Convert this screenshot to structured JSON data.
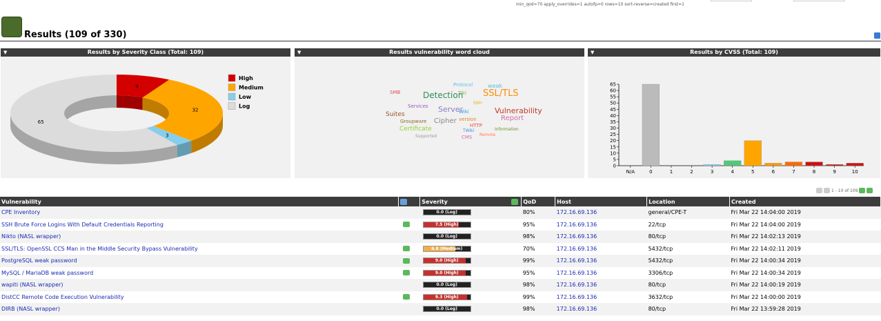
{
  "filter_text": "min_qod=70 apply_overrides=1 autofp=0 rows=10 sort-reverse=created first=1",
  "page_title": "Results (109 of 330)",
  "panels": {
    "severity_title": "Results by Severity Class (Total: 109)",
    "cloud_title": "Results vulnerability word cloud",
    "cvss_title": "Results by CVSS (Total: 109)"
  },
  "chart_data": [
    {
      "type": "pie",
      "title": "Results by Severity Class (Total: 109)",
      "categories": [
        "High",
        "Medium",
        "Low",
        "Log"
      ],
      "values": [
        9,
        32,
        3,
        65
      ],
      "colors": [
        "#d40000",
        "#ffa500",
        "#87ceeb",
        "#dcdcdc"
      ],
      "legend": "top-right"
    },
    {
      "type": "bar",
      "title": "Results by CVSS (Total: 109)",
      "categories": [
        "N/A",
        "0",
        "1",
        "2",
        "3",
        "4",
        "5",
        "6",
        "7",
        "8",
        "9",
        "10"
      ],
      "values": [
        0,
        65,
        0,
        0,
        1,
        4,
        20,
        2,
        3,
        3,
        1,
        2
      ],
      "colors": [
        "#bbbbbb",
        "#bbbbbb",
        "#bbbbbb",
        "#bbbbbb",
        "#87ceeb",
        "#50c878",
        "#ffa500",
        "#ff9900",
        "#ff6a00",
        "#cc1111",
        "#cc1111",
        "#cc1111"
      ],
      "ylim": [
        0,
        65
      ],
      "yticks": [
        0,
        5,
        10,
        15,
        20,
        25,
        30,
        35,
        40,
        45,
        50,
        55,
        60,
        65
      ]
    }
  ],
  "word_cloud": [
    {
      "text": "Protocol",
      "color": "#5bc0de",
      "size": 7
    },
    {
      "text": "weak",
      "color": "#5bc0de",
      "size": 8
    },
    {
      "text": "SMB",
      "color": "#d9534f",
      "size": 7
    },
    {
      "text": "Tiki",
      "color": "#7cb342",
      "size": 7
    },
    {
      "text": "SSL/TLS",
      "color": "#ff8c00",
      "size": 13
    },
    {
      "text": "Detection",
      "color": "#2e8b57",
      "size": 12
    },
    {
      "text": "SSH",
      "color": "#dcb000",
      "size": 6
    },
    {
      "text": "Services",
      "color": "#9b59b6",
      "size": 7
    },
    {
      "text": "Server",
      "color": "#8e7cc3",
      "size": 11
    },
    {
      "text": "Wiki",
      "color": "#3498db",
      "size": 7
    },
    {
      "text": "Vulnerability",
      "color": "#c0392b",
      "size": 11
    },
    {
      "text": "Suites",
      "color": "#a0522d",
      "size": 9
    },
    {
      "text": "version",
      "color": "#e67e22",
      "size": 7
    },
    {
      "text": "Report",
      "color": "#d36fa4",
      "size": 10
    },
    {
      "text": "Groupware",
      "color": "#8b6a2b",
      "size": 7
    },
    {
      "text": "Cipher",
      "color": "#888888",
      "size": 10
    },
    {
      "text": "HTTP",
      "color": "#e74c3c",
      "size": 7
    },
    {
      "text": "Certificate",
      "color": "#9acd32",
      "size": 9
    },
    {
      "text": "TWiki",
      "color": "#3b8ed0",
      "size": 6
    },
    {
      "text": "Information",
      "color": "#6b8e23",
      "size": 6
    },
    {
      "text": "Supported",
      "color": "#999999",
      "size": 6
    },
    {
      "text": "CMS",
      "color": "#e066b0",
      "size": 7
    },
    {
      "text": "Remote",
      "color": "#ff7f50",
      "size": 6
    }
  ],
  "pager": {
    "text": "1 - 10 of 109"
  },
  "table": {
    "headers": {
      "vulnerability": "Vulnerability",
      "severity": "Severity",
      "qod": "QoD",
      "host": "Host",
      "location": "Location",
      "created": "Created"
    },
    "rows": [
      {
        "vuln": "CPE Inventory",
        "note": false,
        "sev": "0.0 (Log)",
        "sev_fraction": 0.0,
        "sev_color": "#222222",
        "qod": "80%",
        "host": "172.16.69.136",
        "loc": "general/CPE-T",
        "created": "Fri Mar 22 14:04:00 2019"
      },
      {
        "vuln": "SSH Brute Force Logins With Default Credentials Reporting",
        "note": true,
        "sev": "7.5 (High)",
        "sev_fraction": 0.75,
        "sev_color": "#c9302c",
        "qod": "95%",
        "host": "172.16.69.136",
        "loc": "22/tcp",
        "created": "Fri Mar 22 14:04:00 2019"
      },
      {
        "vuln": "Nikto (NASL wrapper)",
        "note": false,
        "sev": "0.0 (Log)",
        "sev_fraction": 0.0,
        "sev_color": "#222222",
        "qod": "98%",
        "host": "172.16.69.136",
        "loc": "80/tcp",
        "created": "Fri Mar 22 14:02:13 2019"
      },
      {
        "vuln": "SSL/TLS: OpenSSL CCS Man in the Middle Security Bypass Vulnerability",
        "note": true,
        "sev": "6.8 (Medium)",
        "sev_fraction": 0.68,
        "sev_color": "#f0ad4e",
        "qod": "70%",
        "host": "172.16.69.136",
        "loc": "5432/tcp",
        "created": "Fri Mar 22 14:02:11 2019"
      },
      {
        "vuln": "PostgreSQL weak password",
        "note": true,
        "sev": "9.0 (High)",
        "sev_fraction": 0.9,
        "sev_color": "#c9302c",
        "qod": "99%",
        "host": "172.16.69.136",
        "loc": "5432/tcp",
        "created": "Fri Mar 22 14:00:34 2019"
      },
      {
        "vuln": "MySQL / MariaDB weak password",
        "note": true,
        "sev": "9.0 (High)",
        "sev_fraction": 0.9,
        "sev_color": "#c9302c",
        "qod": "95%",
        "host": "172.16.69.136",
        "loc": "3306/tcp",
        "created": "Fri Mar 22 14:00:34 2019"
      },
      {
        "vuln": "wapiti (NASL wrapper)",
        "note": false,
        "sev": "0.0 (Log)",
        "sev_fraction": 0.0,
        "sev_color": "#222222",
        "qod": "98%",
        "host": "172.16.69.136",
        "loc": "80/tcp",
        "created": "Fri Mar 22 14:00:19 2019"
      },
      {
        "vuln": "DistCC Remote Code Execution Vulnerability",
        "note": true,
        "sev": "9.3 (High)",
        "sev_fraction": 0.93,
        "sev_color": "#c9302c",
        "qod": "99%",
        "host": "172.16.69.136",
        "loc": "3632/tcp",
        "created": "Fri Mar 22 14:00:00 2019"
      },
      {
        "vuln": "DIRB (NASL wrapper)",
        "note": false,
        "sev": "0.0 (Log)",
        "sev_fraction": 0.0,
        "sev_color": "#222222",
        "qod": "98%",
        "host": "172.16.69.136",
        "loc": "80/tcp",
        "created": "Fri Mar 22 13:59:28 2019"
      }
    ]
  }
}
